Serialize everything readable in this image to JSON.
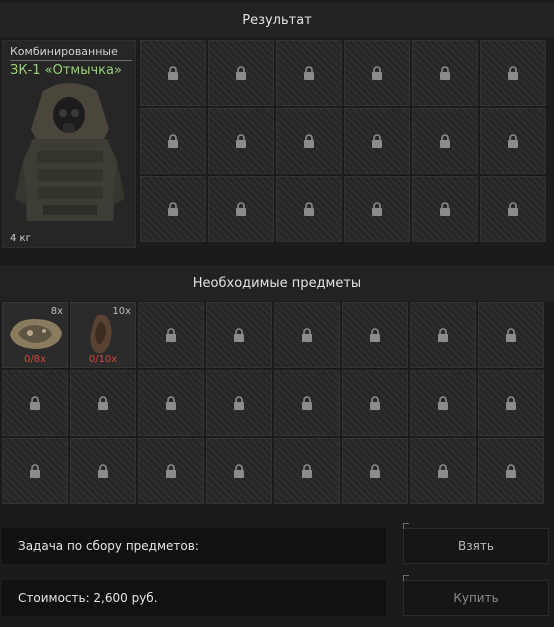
{
  "sections": {
    "result_title": "Результат",
    "required_title": "Необходимые предметы"
  },
  "result_item": {
    "category": "Комбинированные",
    "name": "ЗК-1 «Отмычка»",
    "weight": "4 кг",
    "icon": "armor-vest-icon"
  },
  "result_grid": {
    "rows": 3,
    "cols": 6,
    "locked_icon": "lock-icon"
  },
  "required_items": [
    {
      "icon": "ore-chunk-icon",
      "quantity": "8x",
      "have": "0/8x"
    },
    {
      "icon": "hide-scrap-icon",
      "quantity": "10x",
      "have": "0/10x"
    }
  ],
  "required_grid": {
    "rows": 3,
    "cols": 8,
    "locked_icon": "lock-icon"
  },
  "task": {
    "label": "Задача по сбору предметов:"
  },
  "cost": {
    "label": "Стоимость: 2,600 руб."
  },
  "buttons": {
    "take": "Взять",
    "buy": "Купить"
  },
  "colors": {
    "item_name": "#9ad07a",
    "missing": "#d04a3a"
  }
}
